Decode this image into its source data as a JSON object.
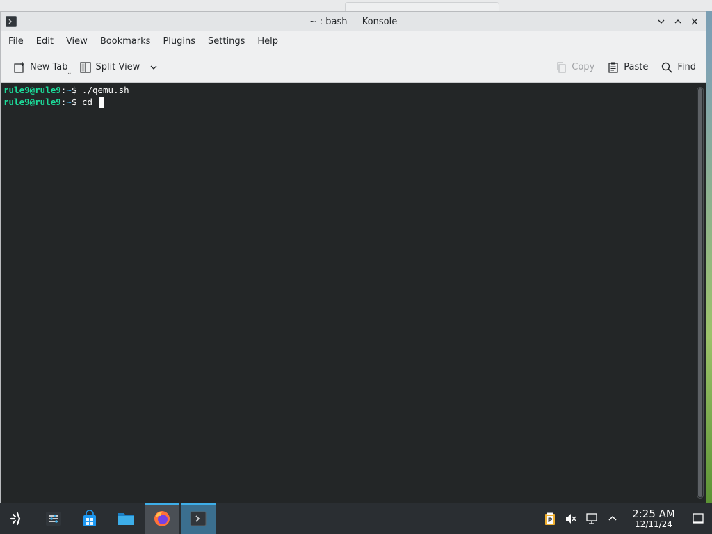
{
  "window": {
    "title": "~ : bash — Konsole"
  },
  "menubar": {
    "items": [
      "File",
      "Edit",
      "View",
      "Bookmarks",
      "Plugins",
      "Settings",
      "Help"
    ]
  },
  "toolbar": {
    "new_tab_label": "New Tab",
    "split_view_label": "Split View",
    "copy_label": "Copy",
    "paste_label": "Paste",
    "find_label": "Find"
  },
  "terminal": {
    "lines": [
      {
        "user": "rule9@rule9",
        "sep": ":",
        "path": "~",
        "dollar": "$",
        "command": " ./qemu.sh"
      },
      {
        "user": "rule9@rule9",
        "sep": ":",
        "path": "~",
        "dollar": "$",
        "command": " cd "
      }
    ]
  },
  "taskbar": {
    "apps": [
      {
        "name": "application-launcher-icon"
      },
      {
        "name": "system-settings-icon"
      },
      {
        "name": "discover-store-icon"
      },
      {
        "name": "dolphin-files-icon"
      },
      {
        "name": "firefox-icon"
      },
      {
        "name": "konsole-icon"
      }
    ],
    "clock_time": "2:25 AM",
    "clock_date": "12/11/24"
  },
  "colors": {
    "terminal_bg": "#232627",
    "prompt_user": "#1cdc9a",
    "prompt_path": "#3daee9",
    "taskbar_bg": "#2a2e32",
    "accent": "#3daee9"
  }
}
